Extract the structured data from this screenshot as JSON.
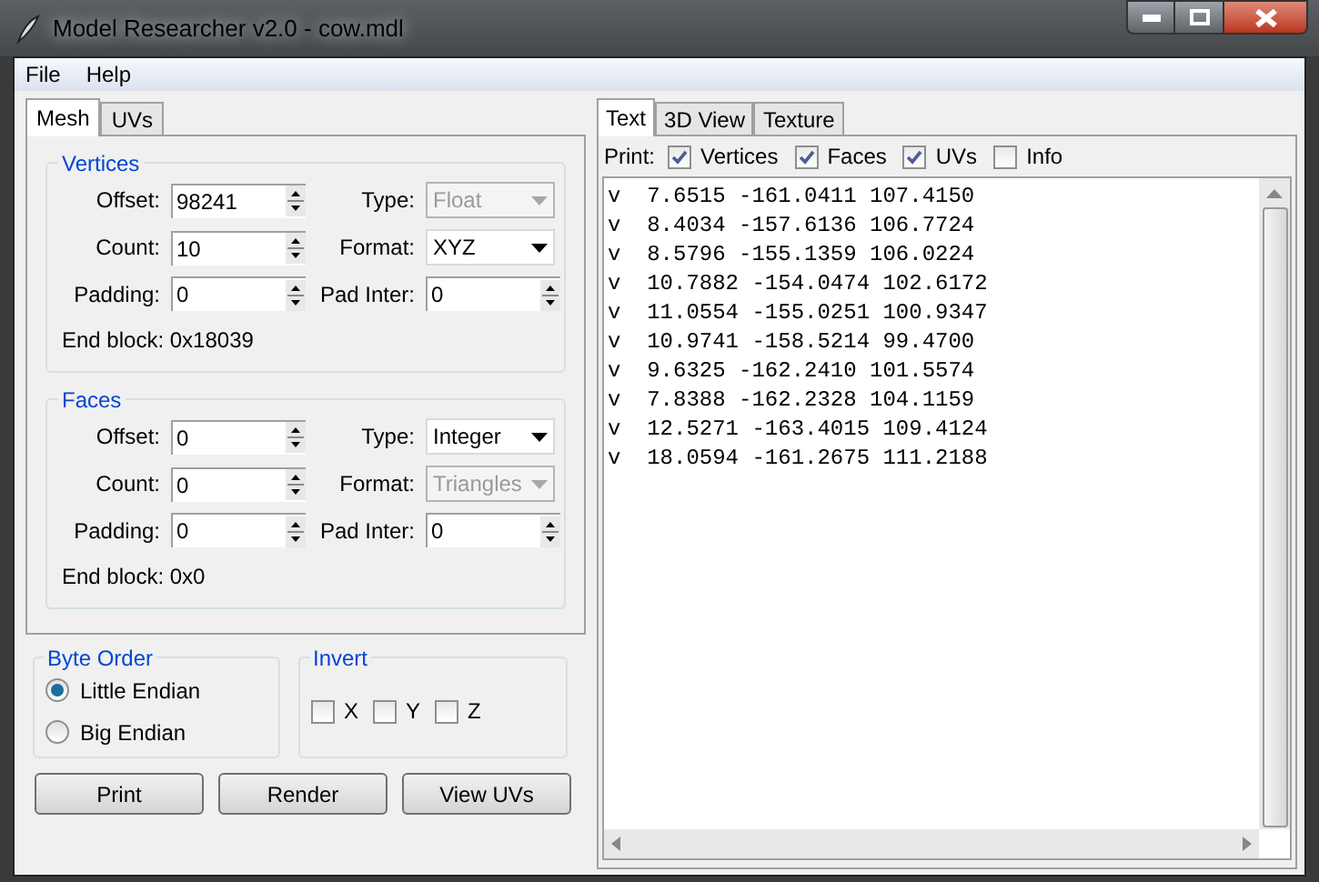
{
  "window": {
    "title": "Model Researcher v2.0 - cow.mdl"
  },
  "menu": [
    "File",
    "Help"
  ],
  "left_tabs": [
    {
      "label": "Mesh",
      "selected": true
    },
    {
      "label": "UVs",
      "selected": false
    }
  ],
  "groups": [
    {
      "title": "Vertices",
      "rows": [
        [
          {
            "label": "Offset:",
            "kind": "spin",
            "value": "98241"
          },
          {
            "label": "Type:",
            "kind": "select",
            "value": "Float",
            "disabled": true
          }
        ],
        [
          {
            "label": "Count:",
            "kind": "spin",
            "value": "10"
          },
          {
            "label": "Format:",
            "kind": "select",
            "value": "XYZ",
            "disabled": false
          }
        ],
        [
          {
            "label": "Padding:",
            "kind": "spin",
            "value": "0"
          },
          {
            "label": "Pad Inter:",
            "kind": "spin",
            "value": "0"
          }
        ]
      ],
      "end_block": "End block: 0x18039"
    },
    {
      "title": "Faces",
      "rows": [
        [
          {
            "label": "Offset:",
            "kind": "spin",
            "value": "0"
          },
          {
            "label": "Type:",
            "kind": "select",
            "value": "Integer",
            "disabled": false
          }
        ],
        [
          {
            "label": "Count:",
            "kind": "spin",
            "value": "0"
          },
          {
            "label": "Format:",
            "kind": "select",
            "value": "Triangles",
            "disabled": true
          }
        ],
        [
          {
            "label": "Padding:",
            "kind": "spin",
            "value": "0"
          },
          {
            "label": "Pad Inter:",
            "kind": "spin",
            "value": "0"
          }
        ]
      ],
      "end_block": "End block: 0x0"
    }
  ],
  "byte_order": {
    "title": "Byte Order",
    "options": [
      {
        "label": "Little Endian",
        "selected": true
      },
      {
        "label": "Big Endian",
        "selected": false
      }
    ]
  },
  "invert": {
    "title": "Invert",
    "options": [
      {
        "label": "X",
        "checked": false
      },
      {
        "label": "Y",
        "checked": false
      },
      {
        "label": "Z",
        "checked": false
      }
    ]
  },
  "buttons": [
    "Print",
    "Render",
    "View UVs"
  ],
  "right_tabs": [
    {
      "label": "Text",
      "selected": true
    },
    {
      "label": "3D View",
      "selected": false
    },
    {
      "label": "Texture",
      "selected": false
    }
  ],
  "print": {
    "label": "Print:",
    "options": [
      {
        "label": "Vertices",
        "checked": true
      },
      {
        "label": "Faces",
        "checked": true
      },
      {
        "label": "UVs",
        "checked": true
      },
      {
        "label": "Info",
        "checked": false
      }
    ]
  },
  "output_lines": [
    "v  7.6515 -161.0411 107.4150",
    "v  8.4034 -157.6136 106.7724",
    "v  8.5796 -155.1359 106.0224",
    "v  10.7882 -154.0474 102.6172",
    "v  11.0554 -155.0251 100.9347",
    "v  10.9741 -158.5214 99.4700",
    "v  9.6325 -162.2410 101.5574",
    "v  7.8388 -162.2328 104.1159",
    "v  12.5271 -163.4015 109.4124",
    "v  18.0594 -161.2675 111.2188"
  ]
}
